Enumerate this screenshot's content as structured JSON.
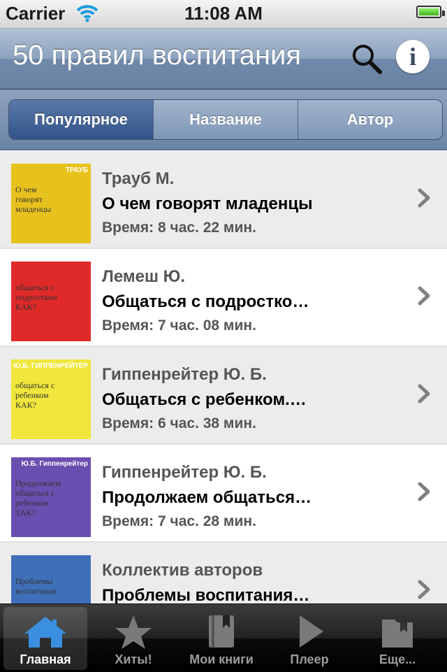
{
  "status_bar": {
    "carrier": "Carrier",
    "time": "11:08 AM",
    "battery_level": 1.0
  },
  "nav": {
    "title": "50 правил воспитания",
    "search_icon": "search-icon",
    "info_icon": "info-icon",
    "info_glyph": "i"
  },
  "segments": [
    {
      "label": "Популярное",
      "selected": true
    },
    {
      "label": "Название",
      "selected": false
    },
    {
      "label": "Автор",
      "selected": false
    }
  ],
  "books": [
    {
      "author": "Трауб М.",
      "title": "О чем говорят младенцы",
      "duration": "Время: 8 час. 22 мин.",
      "cover_color": "#e8c21c",
      "cover_text": "О чем говорят младенцы",
      "cover_brand": "ТРАУБ"
    },
    {
      "author": "Лемеш Ю.",
      "title": "Общаться с подростко…",
      "duration": "Время: 7 час. 08 мин.",
      "cover_color": "#e02a2a",
      "cover_text": "общаться с подростком КАК?",
      "cover_brand": ""
    },
    {
      "author": "Гиппенрейтер Ю. Б.",
      "title": "Общаться с ребенком.…",
      "duration": "Время: 6 час. 38 мин.",
      "cover_color": "#f0e63c",
      "cover_text": "общаться с ребенком КАК?",
      "cover_brand": "Ю.Б. ГИППЕНРЕЙТЕР"
    },
    {
      "author": "Гиппенрейтер Ю. Б.",
      "title": "Продолжаем общаться…",
      "duration": "Время: 7 час. 28 мин.",
      "cover_color": "#6a4fb0",
      "cover_text": "Продолжаем общаться с ребенком ТАК?",
      "cover_brand": "Ю.Б. Гиппенрейтер"
    },
    {
      "author": "Коллектив авторов",
      "title": "Проблемы воспитания…",
      "duration": "",
      "cover_color": "#3f6fb8",
      "cover_text": "Проблемы воспитания",
      "cover_brand": ""
    }
  ],
  "tabs": [
    {
      "label": "Главная",
      "icon": "home-icon",
      "selected": true
    },
    {
      "label": "Хиты!",
      "icon": "star-icon",
      "selected": false
    },
    {
      "label": "Мои книги",
      "icon": "book-icon",
      "selected": false
    },
    {
      "label": "Плеер",
      "icon": "play-icon",
      "selected": false
    },
    {
      "label": "Еще...",
      "icon": "folder-icon",
      "selected": false
    }
  ],
  "colors": {
    "nav_accent": "#7189aa",
    "selected_segment": "#34538a",
    "tab_active": "#3b8fe0"
  }
}
